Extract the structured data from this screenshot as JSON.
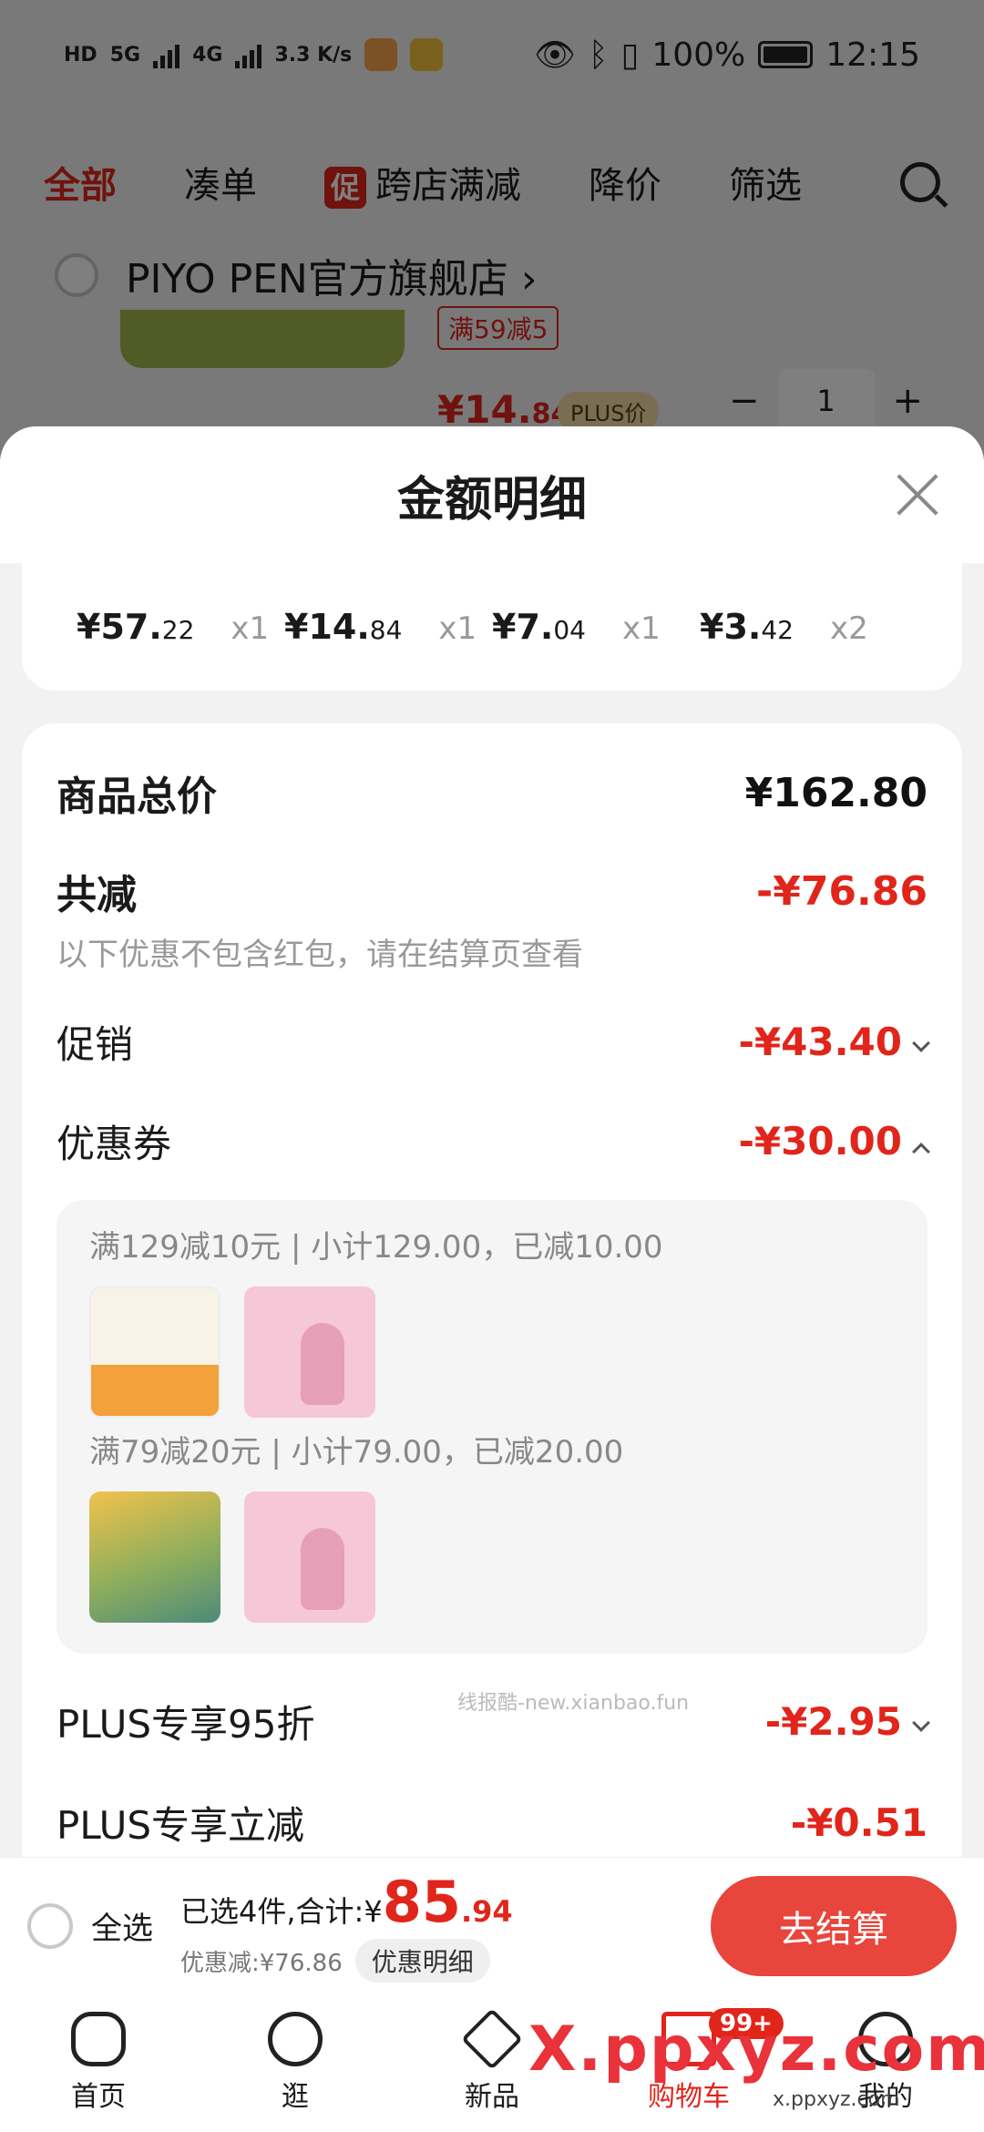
{
  "status_bar": {
    "speed": "3.3 K/s",
    "battery": "100%",
    "time": "12:15",
    "net1": "5G",
    "net2": "4G"
  },
  "filters": {
    "all": "全部",
    "bundle": "凑单",
    "promo_icon": "促",
    "cross_store": "跨店满减",
    "price_drop": "降价",
    "filter": "筛选"
  },
  "shop": {
    "name": "PIYO PEN官方旗舰店 ›",
    "promo_tag": "满59减5",
    "price_int": "¥14.",
    "price_dec": "84",
    "plus_tag": "PLUS价",
    "qty": "1",
    "minus": "−",
    "plus": "+"
  },
  "sheet": {
    "title": "金额明细",
    "items": [
      {
        "int": "¥57.",
        "dec": "22",
        "qty": "x1"
      },
      {
        "int": "¥14.",
        "dec": "84",
        "qty": "x1"
      },
      {
        "int": "¥7.",
        "dec": "04",
        "qty": "x1"
      },
      {
        "int": "¥3.",
        "dec": "42",
        "qty": "x2"
      }
    ],
    "total_label": "商品总价",
    "total_value": "¥162.80",
    "reduce_label": "共减",
    "reduce_value": "-¥76.86",
    "reduce_note": "以下优惠不包含红包，请在结算页查看",
    "promo_label": "促销",
    "promo_value": "-¥43.40",
    "coupon_label": "优惠券",
    "coupon_value": "-¥30.00",
    "coupon_lines": [
      "满129减10元 | 小计129.00，已减10.00",
      "满79减20元 | 小计79.00，已减20.00"
    ],
    "plus95_label": "PLUS专享95折",
    "plus95_value": "-¥2.95",
    "plus_cut_label": "PLUS专享立减",
    "plus_cut_value": "-¥0.51",
    "watermark": "线报酷-new.xianbao.fun"
  },
  "checkout": {
    "select_all": "全选",
    "selected": "已选4件,合计:¥",
    "total_int": "85",
    "total_dec": ".94",
    "discount": "优惠减:¥76.86",
    "detail_btn": "优惠明细",
    "pay": "去结算"
  },
  "tabbar": {
    "home": "首页",
    "browse": "逛",
    "new": "新品",
    "cart": "购物车",
    "cart_badge": "99+",
    "me": "我的"
  },
  "watermark_big": "X.ppxyz.com",
  "watermark_small": "x.ppxyz.com"
}
